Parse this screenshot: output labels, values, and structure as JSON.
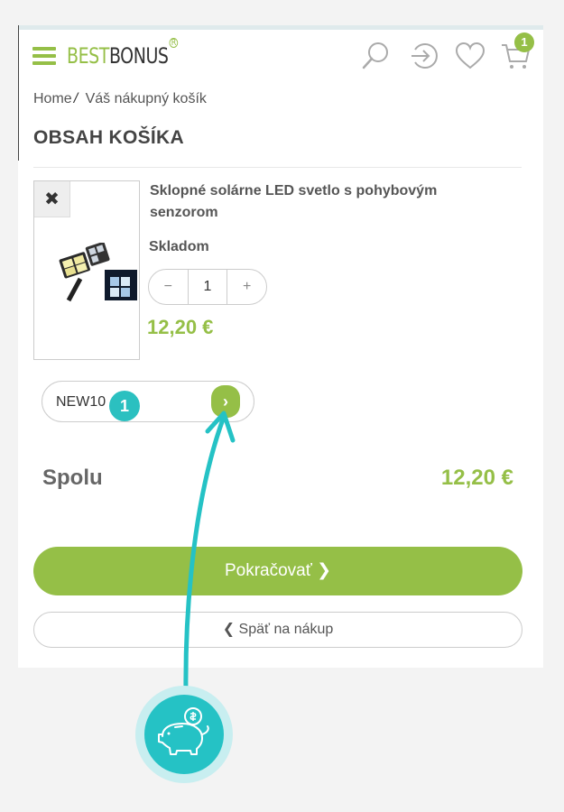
{
  "header": {
    "logo_best": "BEST",
    "logo_bonus": "BONUS",
    "logo_reg": "R",
    "cart_count": "1",
    "icons": [
      "menu-icon",
      "search-icon",
      "login-icon",
      "heart-icon",
      "cart-icon"
    ]
  },
  "breadcrumb": {
    "home": "Home",
    "separator": "/",
    "current": "Váš nákupný košík"
  },
  "page_title": "OBSAH KOŠÍKA",
  "product": {
    "remove_symbol": "✖",
    "name": "Sklopné solárne LED svetlo s pohybovým senzorom",
    "stock": "Skladom",
    "qty_minus": "−",
    "qty_value": "1",
    "qty_plus": "+",
    "price": "12,20 €"
  },
  "coupon": {
    "value": "NEW10",
    "step": "1",
    "submit_symbol": "›"
  },
  "total": {
    "label": "Spolu",
    "value": "12,20 €"
  },
  "buttons": {
    "continue": "Pokračovať ❯",
    "back": "❮ Späť na nákup"
  },
  "colors": {
    "brand": "#95bf47",
    "accent": "#25c2c5"
  }
}
